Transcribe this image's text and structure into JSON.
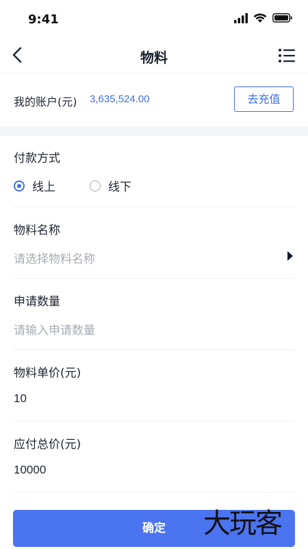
{
  "status_bar": {
    "time": "9:41"
  },
  "nav": {
    "title": "物料"
  },
  "account": {
    "label": "我的账户(元)",
    "balance": "3,635,524.00",
    "recharge_label": "去充值"
  },
  "payment": {
    "label": "付款方式",
    "options": [
      {
        "label": "线上",
        "selected": true
      },
      {
        "label": "线下",
        "selected": false
      }
    ]
  },
  "material_name": {
    "label": "物料名称",
    "placeholder": "请选择物料名称"
  },
  "apply_quantity": {
    "label": "申请数量",
    "placeholder": "请输入申请数量"
  },
  "unit_price": {
    "label": "物料单价(元)",
    "value": "10"
  },
  "total_price": {
    "label": "应付总价(元)",
    "value": "10000"
  },
  "confirm": {
    "label": "确定"
  },
  "watermark": {
    "text": "大玩客"
  },
  "colors": {
    "accent": "#3f6fe4",
    "button": "#4b74f0",
    "placeholder": "#a7abb4"
  }
}
